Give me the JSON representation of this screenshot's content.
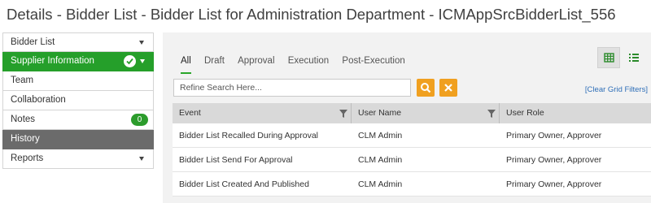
{
  "page": {
    "title": "Details - Bidder List - Bidder List for Administration Department - ICMAppSrcBidderList_556"
  },
  "sidebar": {
    "items": [
      {
        "label": "Bidder List"
      },
      {
        "label": "Supplier Information"
      },
      {
        "label": "Team"
      },
      {
        "label": "Collaboration"
      },
      {
        "label": "Notes",
        "badge": "0"
      },
      {
        "label": "History"
      },
      {
        "label": "Reports"
      }
    ]
  },
  "tabs": [
    "All",
    "Draft",
    "Approval",
    "Execution",
    "Post-Execution"
  ],
  "search": {
    "placeholder": "Refine Search Here...",
    "clear_filters_label": "[Clear Grid Filters]"
  },
  "grid": {
    "columns": [
      "Event",
      "User Name",
      "User Role"
    ],
    "rows": [
      [
        "Bidder List Recalled During Approval",
        "CLM Admin",
        "Primary Owner, Approver"
      ],
      [
        "Bidder List Send For Approval",
        "CLM Admin",
        "Primary Owner, Approver"
      ],
      [
        "Bidder List Created And Published",
        "CLM Admin",
        "Primary Owner, Approver"
      ]
    ]
  },
  "colors": {
    "active_green": "#259f2a",
    "active_dark": "#6b6b6b",
    "action_orange": "#f0a020",
    "link_blue": "#2f6fb8"
  },
  "icons": [
    "check-icon",
    "chevron-down-icon",
    "search-icon",
    "close-icon",
    "grid-view-icon",
    "list-view-icon",
    "filter-icon"
  ]
}
